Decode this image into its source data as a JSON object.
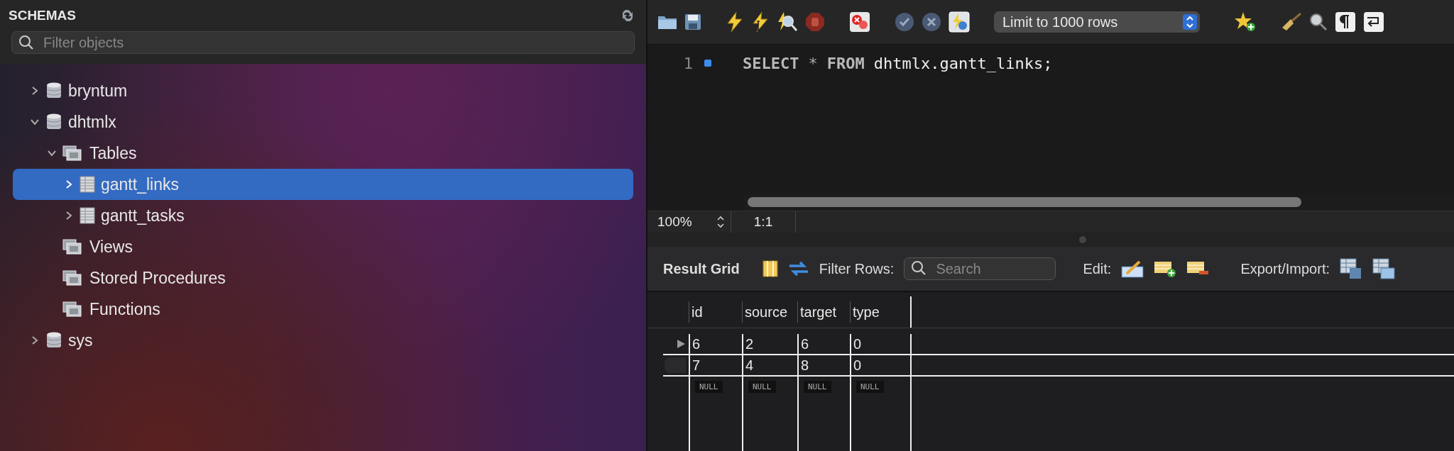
{
  "sidebar": {
    "title": "SCHEMAS",
    "filter": {
      "placeholder": "Filter objects"
    },
    "tree": [
      {
        "label": "bryntum",
        "kind": "schema",
        "expanded": false,
        "selected": false
      },
      {
        "label": "dhtmlx",
        "kind": "schema",
        "expanded": true,
        "selected": false,
        "children": [
          {
            "label": "Tables",
            "kind": "folder",
            "expanded": true,
            "selected": false,
            "children": [
              {
                "label": "gantt_links",
                "kind": "table",
                "expanded": false,
                "selected": true
              },
              {
                "label": "gantt_tasks",
                "kind": "table",
                "expanded": false,
                "selected": false
              }
            ]
          },
          {
            "label": "Views",
            "kind": "folder",
            "selected": false
          },
          {
            "label": "Stored Procedures",
            "kind": "folder",
            "selected": false
          },
          {
            "label": "Functions",
            "kind": "folder",
            "selected": false
          }
        ]
      },
      {
        "label": "sys",
        "kind": "schema",
        "expanded": false,
        "selected": false
      }
    ]
  },
  "toolbar": {
    "limit_select": "Limit to 1000 rows"
  },
  "editor": {
    "lines": [
      {
        "number": "1",
        "tokens": [
          {
            "kind": "keyword",
            "text": "SELECT"
          },
          {
            "kind": "operator",
            "text": "*"
          },
          {
            "kind": "keyword",
            "text": "FROM"
          },
          {
            "kind": "identifier",
            "text": "dhtmlx.gantt_links;"
          }
        ]
      }
    ]
  },
  "status_bar": {
    "zoom": "100%",
    "position": "1:1"
  },
  "result": {
    "title": "Result Grid",
    "filter_label": "Filter Rows:",
    "search_placeholder": "Search",
    "edit_label": "Edit:",
    "export_label": "Export/Import:",
    "columns": [
      "id",
      "source",
      "target",
      "type"
    ],
    "rows": [
      {
        "cells": [
          "6",
          "2",
          "6",
          "0"
        ],
        "selected": true
      },
      {
        "cells": [
          "7",
          "4",
          "8",
          "0"
        ],
        "selected": false
      }
    ],
    "new_row": [
      "NULL",
      "NULL",
      "NULL",
      "NULL"
    ]
  }
}
